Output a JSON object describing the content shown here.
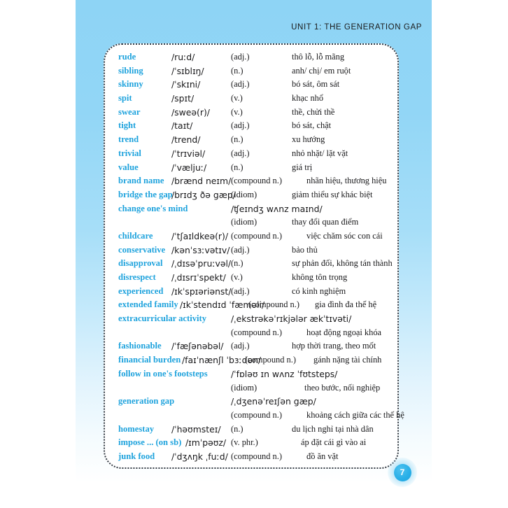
{
  "header": {
    "running_title": "UNIT 1: THE GENERATION GAP"
  },
  "page": {
    "number": "7",
    "accent_color": "#1fa3dd",
    "panel_color_top": "#8ed4f5",
    "panel_color_bottom": "#ffffff",
    "box_border_color": "#333b44"
  },
  "vocabulary": {
    "rows": [
      {
        "word": "rude",
        "phonetic": "/ruːd/",
        "pos": "(adj.)",
        "meaning": "thô lỗ, lỗ mãng"
      },
      {
        "word": "sibling",
        "phonetic": "/ˈsɪblɪŋ/",
        "pos": "(n.)",
        "meaning": "anh/ chị/ em ruột"
      },
      {
        "word": "skinny",
        "phonetic": "/ˈskɪni/",
        "pos": "(adj.)",
        "meaning": "bó sát, ôm sát"
      },
      {
        "word": "spit",
        "phonetic": "/spɪt/",
        "pos": "(v.)",
        "meaning": "khạc nhổ"
      },
      {
        "word": "swear",
        "phonetic": "/sweə(r)/",
        "pos": "(v.)",
        "meaning": "thề, chửi thề"
      },
      {
        "word": "tight",
        "phonetic": "/taɪt/",
        "pos": "(adj.)",
        "meaning": "bó sát, chật"
      },
      {
        "word": "trend",
        "phonetic": "/trend/",
        "pos": "(n.)",
        "meaning": "xu hướng"
      },
      {
        "word": "trivial",
        "phonetic": "/ˈtrɪviəl/",
        "pos": "(adj.)",
        "meaning": "nhỏ nhặt/ lặt vặt"
      },
      {
        "word": "value",
        "phonetic": "/ˈvæljuː/",
        "pos": "(n.)",
        "meaning": "giá trị"
      },
      {
        "word": "brand name",
        "phonetic": "/brænd neɪm/",
        "pos": "(compound n.)",
        "meaning": "nhãn hiệu, thương hiệu"
      },
      {
        "word": "bridge the gap",
        "phonetic": "/brɪdʒ ðə gæp/",
        "pos": "(idiom)",
        "meaning": "giảm thiểu sự khác biệt"
      },
      {
        "word": "change one's mind",
        "phonetic": "/ʧeɪndʒ wʌnz maɪnd/",
        "pos": "",
        "meaning": ""
      },
      {
        "word": "",
        "phonetic": "",
        "pos": "(idiom)",
        "meaning": "thay đổi quan điểm"
      },
      {
        "word": "childcare",
        "phonetic": "/ˈtʃaɪldkeə(r)/",
        "pos": "(compound n.)",
        "meaning": "việc chăm sóc con cái"
      },
      {
        "word": "conservative",
        "phonetic": "/kənˈsɜːvətɪv/",
        "pos": "(adj.)",
        "meaning": "bảo thủ"
      },
      {
        "word": "disapproval",
        "phonetic": "/ˌdɪsəˈpruːvəl/",
        "pos": "(n.)",
        "meaning": "sự phản đối, không tán thành"
      },
      {
        "word": "disrespect",
        "phonetic": "/ˌdɪsrɪˈspekt/",
        "pos": "(v.)",
        "meaning": "không tôn trọng"
      },
      {
        "word": "experienced",
        "phonetic": "/ɪkˈspɪəriənst/",
        "pos": "(adj.)",
        "meaning": "có kinh nghiệm"
      },
      {
        "word": "extended family",
        "phonetic": "/ɪkˈstendɪd ˈfæməli/",
        "pos": "(compound n.)",
        "meaning": "gia đình đa thế hệ"
      },
      {
        "word": "extracurricular activity",
        "phonetic": "/ˌekstrəkəˈrɪkjələr ækˈtɪvəti/",
        "pos": "",
        "meaning": ""
      },
      {
        "word": "",
        "phonetic": "",
        "pos": "(compound n.)",
        "meaning": "hoạt động ngoại khóa"
      },
      {
        "word": "fashionable",
        "phonetic": "/ˈfæʃənəbəl/",
        "pos": "(adj.)",
        "meaning": "hợp thời trang, theo mốt"
      },
      {
        "word": "financial burden",
        "phonetic": "/faɪˈnænʃl ˈbɜːdən/",
        "pos": "(compound n.)",
        "meaning": "gánh nặng tài chính"
      },
      {
        "word": "follow in one's footsteps",
        "phonetic": "/ˈfɒləʊ ɪn wʌnz ˈfʊtsteps/",
        "pos": "",
        "meaning": ""
      },
      {
        "word": "",
        "phonetic": "",
        "pos": "(idiom)",
        "meaning": "theo bước, nối nghiệp"
      },
      {
        "word": "generation gap",
        "phonetic": "/ˌdʒenəˈreɪʃən gæp/",
        "pos": "",
        "meaning": ""
      },
      {
        "word": "",
        "phonetic": "",
        "pos": "(compound n.)",
        "meaning": "khoảng cách giữa các thế hệ"
      },
      {
        "word": "homestay",
        "phonetic": "/ˈhəʊmsteɪ/",
        "pos": "(n.)",
        "meaning": "du lịch nghỉ tại nhà dân"
      },
      {
        "word": "impose ... (on sb)",
        "phonetic": "/ɪmˈpəʊz/",
        "pos": "(v. phr.)",
        "meaning": "áp đặt cái gì vào ai"
      },
      {
        "word": "junk food",
        "phonetic": "/ˈdʒʌŋk ˌfuːd/",
        "pos": "(compound n.)",
        "meaning": "đồ ăn vặt"
      }
    ]
  }
}
